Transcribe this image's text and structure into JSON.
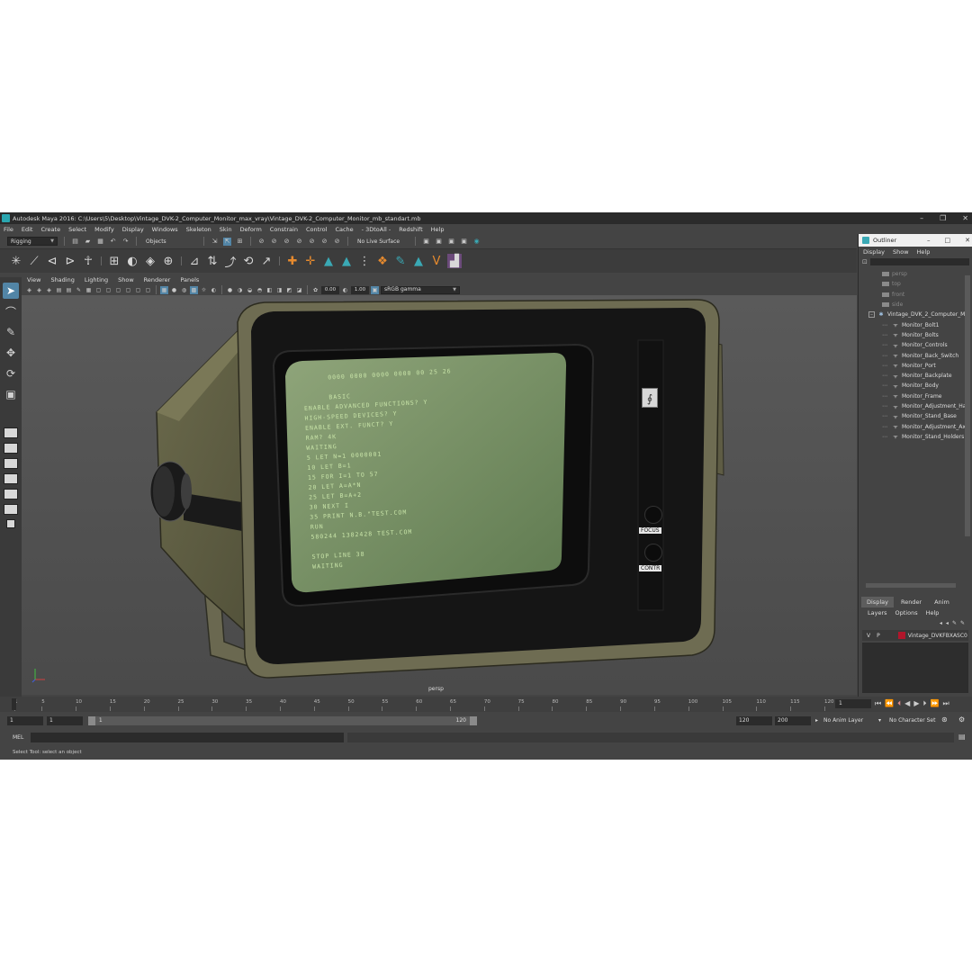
{
  "window": {
    "title": "Autodesk Maya 2016: C:\\Users\\5\\Desktop\\Vintage_DVK-2_Computer_Monitor_max_vray\\Vintage_DVK-2_Computer_Monitor_mb_standart.mb",
    "minimize": "–",
    "maximize": "❐",
    "close": "✕"
  },
  "menubar": [
    "File",
    "Edit",
    "Create",
    "Select",
    "Modify",
    "Display",
    "Windows",
    "Skeleton",
    "Skin",
    "Deform",
    "Constrain",
    "Control",
    "Cache",
    "- 3DtoAll -",
    "Redshift",
    "Help"
  ],
  "statusline": {
    "mode": "Rigging",
    "selection_mode": "Objects",
    "live_surface": "No Live Surface"
  },
  "viewport": {
    "menu": [
      "View",
      "Shading",
      "Lighting",
      "Show",
      "Renderer",
      "Panels"
    ],
    "exposure": "0.00",
    "gamma": "1.00",
    "color_space": "sRGB gamma",
    "camera_label": "persp"
  },
  "monitor": {
    "screen_lines": [
      "0000 0000 0000 0000 00 25 26",
      "BASIC",
      "ENABLE ADVANCED FUNCTIONS? Y",
      "HIGH-SPEED DEVICES? Y",
      "ENABLE EXT. FUNCT? Y",
      "RAM? 4K",
      "WAITING",
      "5 LET N=1 0000001",
      "10 LET B=1",
      "15 FOR I=1 TO 57",
      "20 LET A=A*N",
      "25 LET B=A+2",
      "30 NEXT I",
      "35 PRINT N.B.\"TEST.COM",
      "RUN",
      "580244 1382428 TEST.COM",
      "STOP LINE 38",
      "WAITING"
    ],
    "focus_label": "FOCUS",
    "contr_label": "CONTR",
    "logo": "∮"
  },
  "outliner": {
    "title": "Outliner",
    "menu": [
      "Display",
      "Show",
      "Help"
    ],
    "cameras": [
      "persp",
      "top",
      "front",
      "side"
    ],
    "group": "Vintage_DVK_2_Computer_M",
    "children": [
      "Monitor_Bolt1",
      "Monitor_Bolts",
      "Monitor_Controls",
      "Monitor_Back_Switch",
      "Monitor_Port",
      "Monitor_Backplate",
      "Monitor_Body",
      "Monitor_Frame",
      "Monitor_Adjustment_Har",
      "Monitor_Stand_Base",
      "Monitor_Adjustment_Axe",
      "Monitor_Stand_Holders"
    ]
  },
  "layers": {
    "tabs": [
      "Display",
      "Render",
      "Anim"
    ],
    "menu": [
      "Layers",
      "Options",
      "Help"
    ],
    "layer_v": "V",
    "layer_p": "P",
    "layer_name": "Vintage_DVKFBXASC0",
    "layer_color": "#b0162b"
  },
  "timeline": {
    "ticks": [
      "1",
      "5",
      "10",
      "15",
      "20",
      "25",
      "30",
      "35",
      "40",
      "45",
      "50",
      "55",
      "60",
      "65",
      "70",
      "75",
      "80",
      "85",
      "90",
      "95",
      "100",
      "105",
      "110",
      "115",
      "120"
    ],
    "current_frame": "1"
  },
  "range": {
    "start": "1",
    "start_inner": "1",
    "slider_start": "1",
    "slider_end": "120",
    "end_inner": "120",
    "end": "200",
    "anim_layer": "No Anim Layer",
    "character_set": "No Character Set"
  },
  "command": {
    "label": "MEL",
    "help": "Select Tool: select an object"
  }
}
